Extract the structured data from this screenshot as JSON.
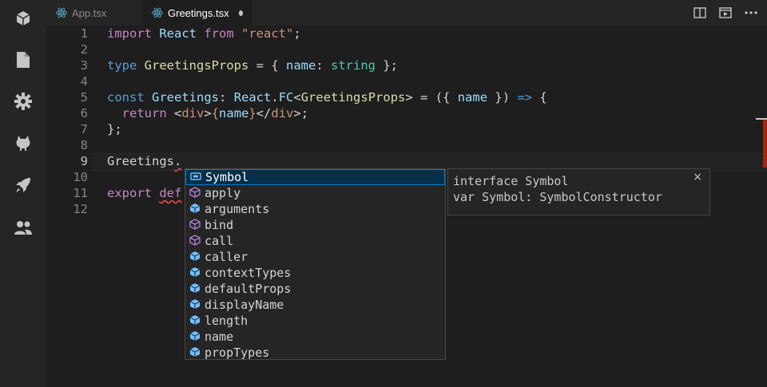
{
  "activity_bar": {
    "icons": [
      "cube-icon",
      "file-icon",
      "gear-icon",
      "github-icon",
      "rocket-icon",
      "users-icon"
    ]
  },
  "tabs": [
    {
      "label": "App.tsx",
      "active": false
    },
    {
      "label": "Greetings.tsx",
      "active": true,
      "modified": true
    }
  ],
  "titlebar_icons": [
    "split-editor-icon",
    "preview-icon",
    "more-icon"
  ],
  "editor": {
    "current_line": 9,
    "line_numbers": [
      "1",
      "2",
      "3",
      "4",
      "5",
      "6",
      "7",
      "8",
      "9",
      "10",
      "11",
      "12"
    ],
    "lines": [
      [
        {
          "t": "import",
          "c": "kw"
        },
        {
          "t": " React ",
          "c": "var"
        },
        {
          "t": "from",
          "c": "kw"
        },
        {
          "t": " ",
          "c": "plain"
        },
        {
          "t": "\"react\"",
          "c": "str"
        },
        {
          "t": ";",
          "c": "plain"
        }
      ],
      [],
      [
        {
          "t": "type",
          "c": "kw2"
        },
        {
          "t": " ",
          "c": "plain"
        },
        {
          "t": "GreetingsProps",
          "c": "typ"
        },
        {
          "t": " = { ",
          "c": "plain"
        },
        {
          "t": "name",
          "c": "var"
        },
        {
          "t": ": ",
          "c": "plain"
        },
        {
          "t": "string",
          "c": "ty2"
        },
        {
          "t": " };",
          "c": "plain"
        }
      ],
      [],
      [
        {
          "t": "const",
          "c": "kw2"
        },
        {
          "t": " ",
          "c": "plain"
        },
        {
          "t": "Greetings",
          "c": "var"
        },
        {
          "t": ": ",
          "c": "plain"
        },
        {
          "t": "React",
          "c": "var"
        },
        {
          "t": ".",
          "c": "plain"
        },
        {
          "t": "FC",
          "c": "var"
        },
        {
          "t": "<",
          "c": "plain"
        },
        {
          "t": "GreetingsProps",
          "c": "typ"
        },
        {
          "t": "> = ({ ",
          "c": "plain"
        },
        {
          "t": "name",
          "c": "var"
        },
        {
          "t": " }) ",
          "c": "plain"
        },
        {
          "t": "=>",
          "c": "kw2"
        },
        {
          "t": " {",
          "c": "plain"
        }
      ],
      [
        {
          "t": "  ",
          "c": "plain"
        },
        {
          "t": "return",
          "c": "kw"
        },
        {
          "t": " <",
          "c": "plain"
        },
        {
          "t": "div",
          "c": "str"
        },
        {
          "t": ">",
          "c": "plain"
        },
        {
          "t": "{",
          "c": "str"
        },
        {
          "t": "name",
          "c": "var"
        },
        {
          "t": "}",
          "c": "str"
        },
        {
          "t": "</",
          "c": "plain"
        },
        {
          "t": "div",
          "c": "str"
        },
        {
          "t": ">;",
          "c": "plain"
        }
      ],
      [
        {
          "t": "};",
          "c": "plain"
        }
      ],
      [],
      [
        {
          "t": "Greetings",
          "c": "plain"
        },
        {
          "t": ".",
          "c": "plain squig"
        }
      ],
      [],
      [
        {
          "t": "export",
          "c": "kw"
        },
        {
          "t": " ",
          "c": "plain"
        },
        {
          "t": "def",
          "c": "kw squig"
        }
      ],
      []
    ]
  },
  "suggest": {
    "items": [
      {
        "label": "Symbol",
        "kind": "variable",
        "selected": true
      },
      {
        "label": "apply",
        "kind": "method",
        "selected": false
      },
      {
        "label": "arguments",
        "kind": "field",
        "selected": false
      },
      {
        "label": "bind",
        "kind": "method",
        "selected": false
      },
      {
        "label": "call",
        "kind": "method",
        "selected": false
      },
      {
        "label": "caller",
        "kind": "field",
        "selected": false
      },
      {
        "label": "contextTypes",
        "kind": "field",
        "selected": false
      },
      {
        "label": "defaultProps",
        "kind": "field",
        "selected": false
      },
      {
        "label": "displayName",
        "kind": "field",
        "selected": false
      },
      {
        "label": "length",
        "kind": "field",
        "selected": false
      },
      {
        "label": "name",
        "kind": "field",
        "selected": false
      },
      {
        "label": "propTypes",
        "kind": "field",
        "selected": false
      }
    ]
  },
  "details": {
    "line1": "interface Symbol",
    "line2": "var Symbol: SymbolConstructor",
    "close_label": "×"
  },
  "colors": {
    "keyword": "#c586c0",
    "keyword_blue": "#569cd6",
    "string": "#ce9178",
    "type": "#dcdcaa",
    "variable": "#9cdcfe",
    "error": "#f14c4c"
  }
}
